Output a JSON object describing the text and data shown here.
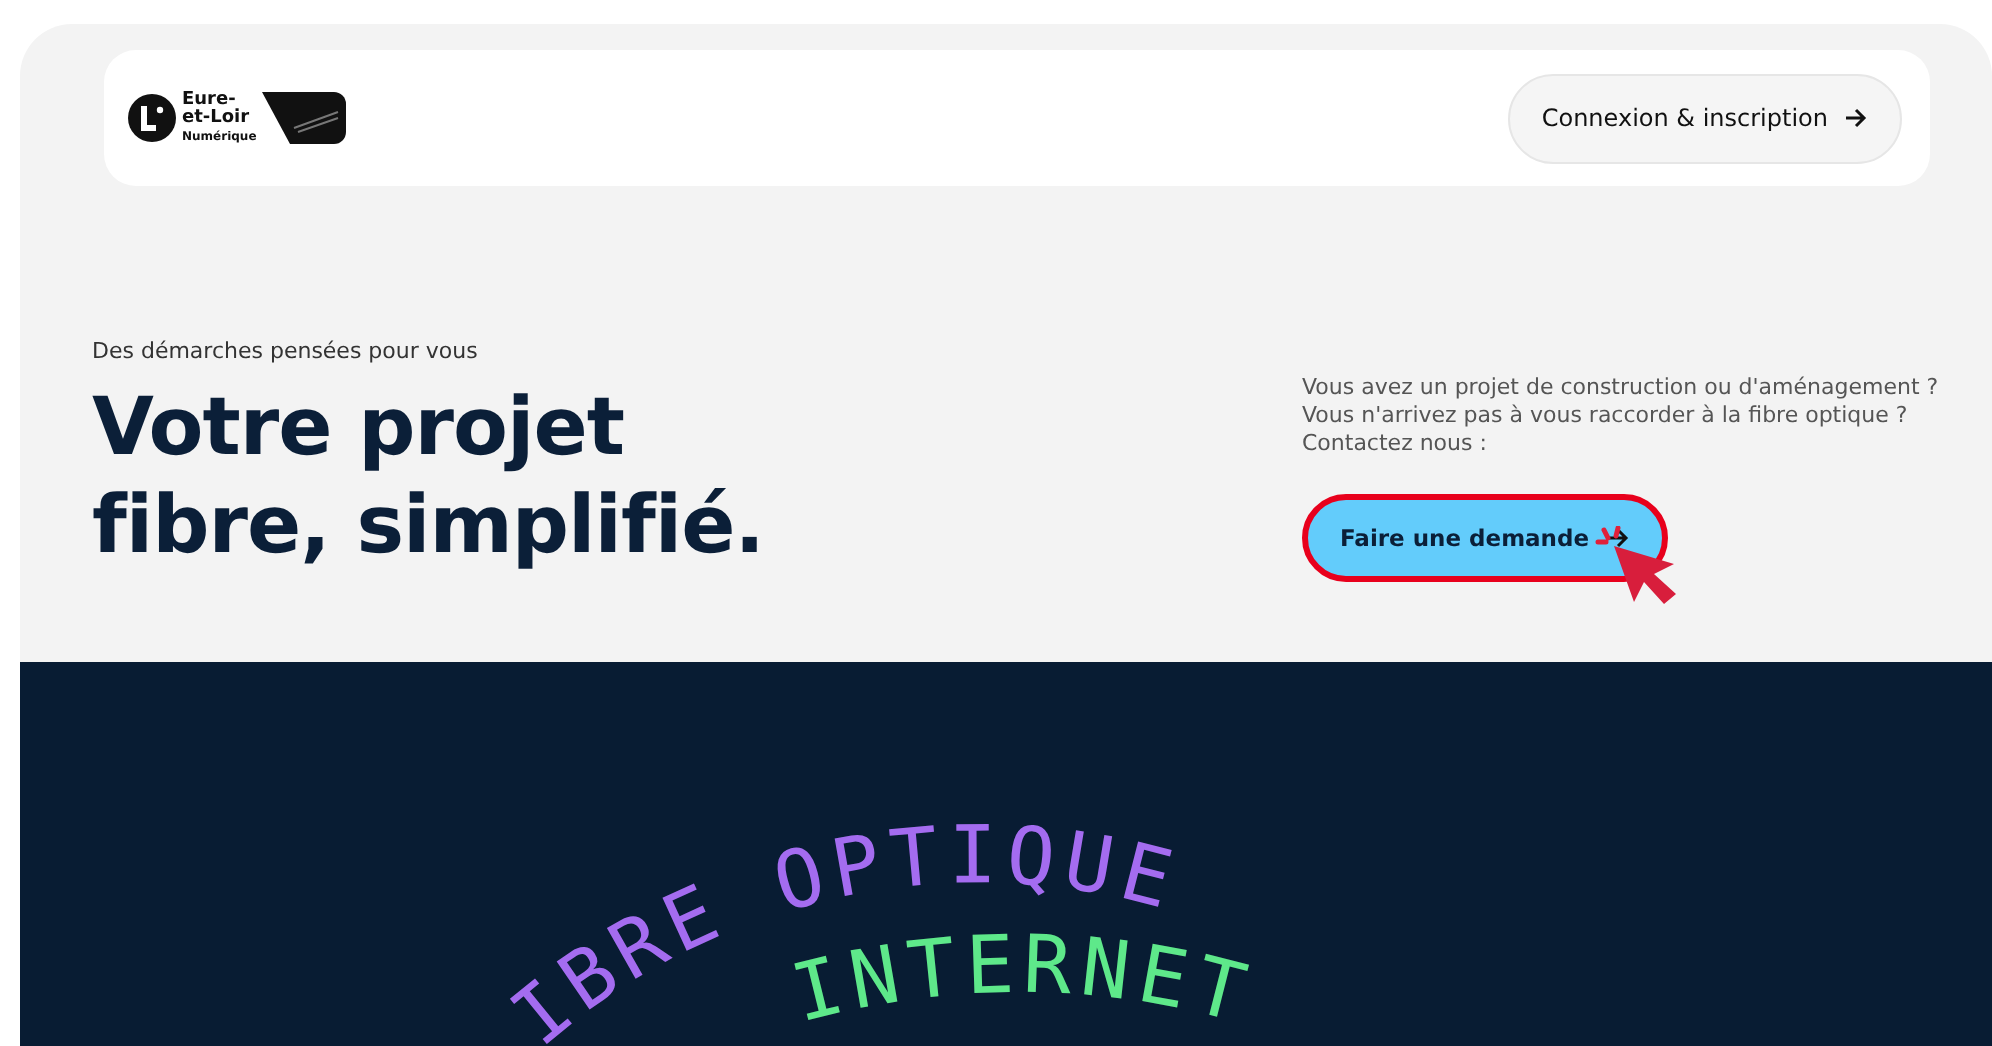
{
  "header": {
    "logo": {
      "line_1": "Eure-",
      "line_2": "et-Loir",
      "line_3": "Numérique"
    },
    "login_button": "Connexion & inscription"
  },
  "hero": {
    "eyebrow": "Des démarches pensées pour vous",
    "title_line_1": "Votre projet",
    "title_line_2": "fibre, simplifié.",
    "description": "Vous avez un projet de construction ou d'aménagement ? Vous n'arrivez pas à vous raccorder à la fibre optique ? Contactez nous :",
    "cta_button": "Faire une demande"
  },
  "banner": {
    "rings": [
      {
        "words": [
          "IBRE",
          "OPTIQUE"
        ],
        "color": "#a46cf0"
      },
      {
        "words": [
          "INTERNET"
        ],
        "color": "#5ee88a"
      }
    ]
  }
}
